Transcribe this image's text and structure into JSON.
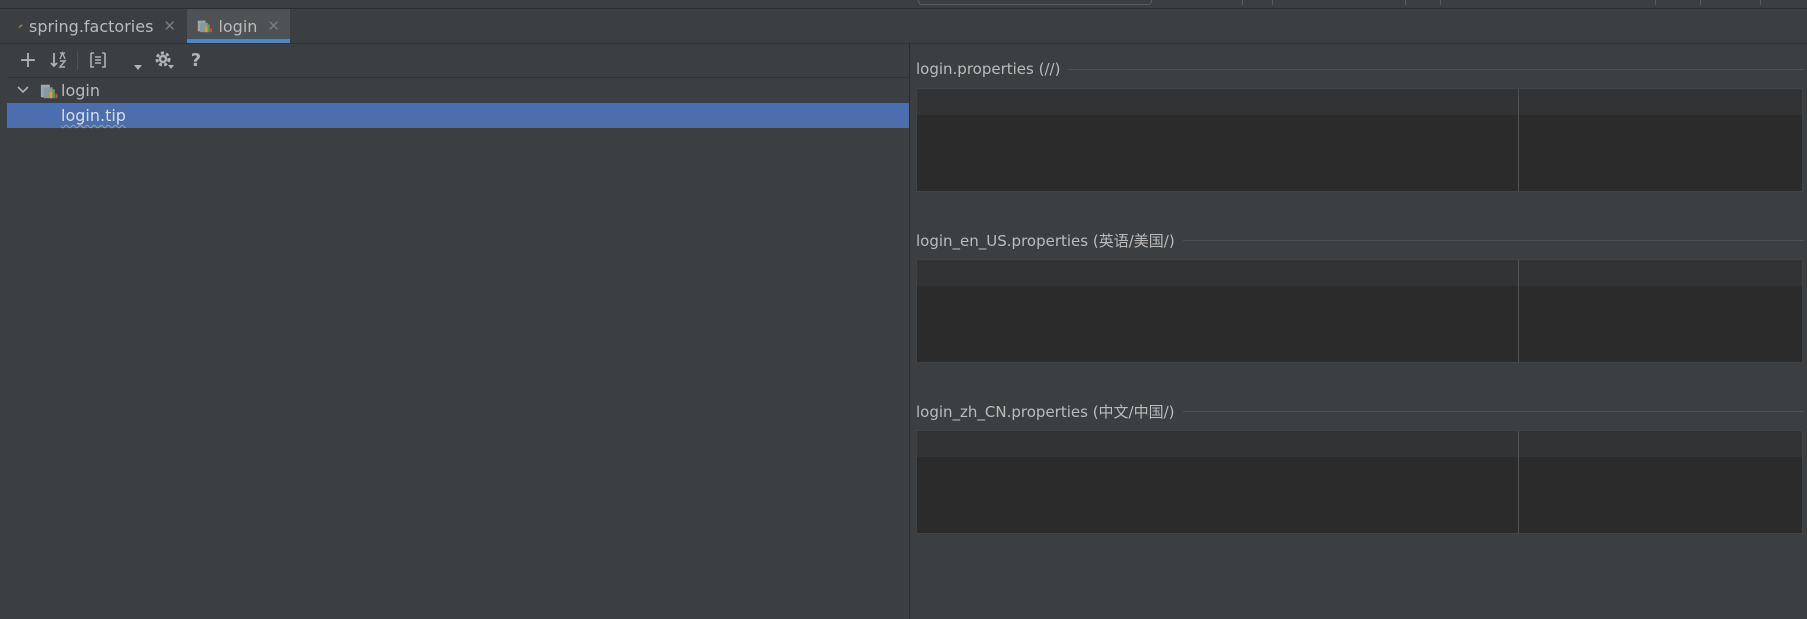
{
  "tabs": [
    {
      "label": "spring.factories",
      "icon": "spring-leaf-icon",
      "active": false
    },
    {
      "label": "login",
      "icon": "resource-bundle-icon",
      "active": true
    }
  ],
  "toolbar": {
    "add": "+",
    "help": "?"
  },
  "tree": {
    "root_label": "login",
    "child_label": "login.tip"
  },
  "sections": [
    {
      "title": "login.properties (//)"
    },
    {
      "title": "login_en_US.properties (英语/美国/)"
    },
    {
      "title": "login_zh_CN.properties (中文/中国/)"
    }
  ],
  "colors": {
    "background": "#3c3f41",
    "selection": "#4b6eaf",
    "tab_accent": "#4a88c7",
    "editor_bg": "#2b2b2b"
  }
}
